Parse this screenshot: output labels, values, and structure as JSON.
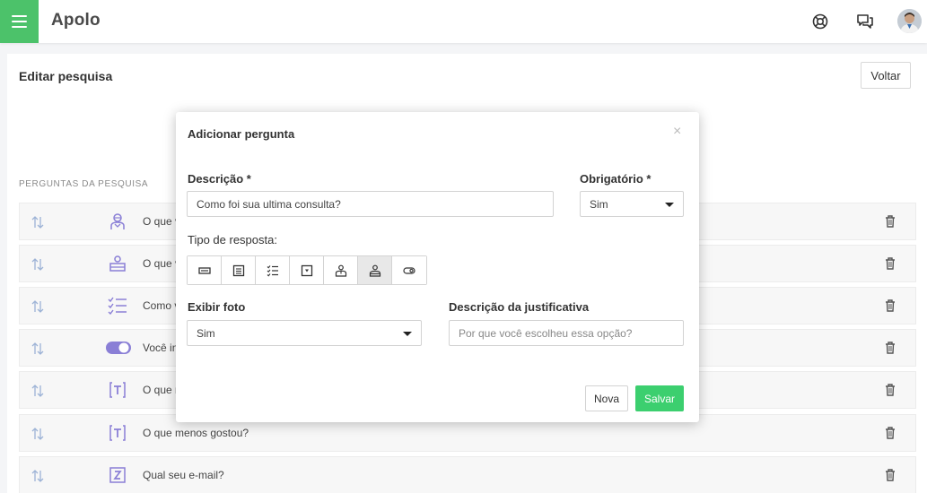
{
  "header": {
    "brand": "Apolo",
    "icons": [
      "menu-icon",
      "lifebuoy-icon",
      "chat-icon",
      "avatar"
    ],
    "accent_color": "#4cc26a"
  },
  "page": {
    "title": "Editar pesquisa",
    "back_label": "Voltar",
    "section_label": "PERGUNTAS DA PESQUISA"
  },
  "questions": [
    {
      "icon": "user-badge-icon",
      "text": "O que v"
    },
    {
      "icon": "bed-icon",
      "text": "O que v"
    },
    {
      "icon": "checklist-icon",
      "text": "Como v"
    },
    {
      "icon": "toggle-icon",
      "text": "Você in"
    },
    {
      "icon": "text-box-icon",
      "text": "O que m"
    },
    {
      "icon": "text-box-icon",
      "text": "O que menos gostou?"
    },
    {
      "icon": "z-box-icon",
      "text": "Qual seu e-mail?"
    }
  ],
  "modal": {
    "title": "Adicionar pergunta",
    "close": "×",
    "descricao_label": "Descrição *",
    "descricao_value": "Como foi sua ultima consulta?",
    "obrigatorio_label": "Obrigatório *",
    "obrigatorio_value": "Sim",
    "tipo_label": "Tipo de resposta:",
    "tipo_options": [
      "short-text-icon",
      "paragraph-icon",
      "checklist-icon",
      "dropdown-icon",
      "person-icon",
      "person-active-icon",
      "toggle-icon"
    ],
    "tipo_selected_index": 5,
    "exibir_label": "Exibir foto",
    "exibir_value": "Sim",
    "justificativa_label": "Descrição da justificativa",
    "justificativa_placeholder": "Por que você escolheu essa opção?",
    "nova_label": "Nova",
    "salvar_label": "Salvar",
    "salvar_color": "#3ccf6f"
  }
}
